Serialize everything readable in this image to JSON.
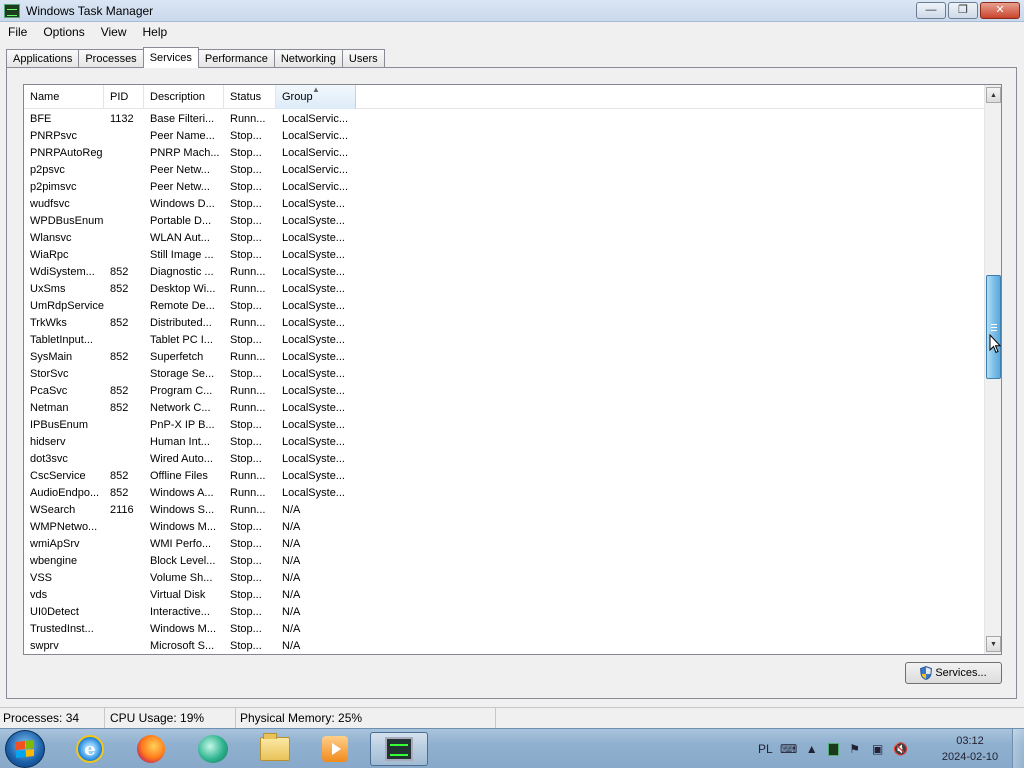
{
  "window": {
    "title": "Windows Task Manager",
    "minimize_symbol": "—",
    "restore_symbol": "❐",
    "close_symbol": "✕"
  },
  "menu": [
    "File",
    "Options",
    "View",
    "Help"
  ],
  "tabs": [
    {
      "label": "Applications",
      "active": false
    },
    {
      "label": "Processes",
      "active": false
    },
    {
      "label": "Services",
      "active": true
    },
    {
      "label": "Performance",
      "active": false
    },
    {
      "label": "Networking",
      "active": false
    },
    {
      "label": "Users",
      "active": false
    }
  ],
  "list": {
    "columns": [
      "Name",
      "PID",
      "Description",
      "Status",
      "Group"
    ],
    "sorted_column": "Group",
    "rows": [
      [
        "BFE",
        "1132",
        "Base Filteri...",
        "Runn...",
        "LocalServic..."
      ],
      [
        "PNRPsvc",
        "",
        "Peer Name...",
        "Stop...",
        "LocalServic..."
      ],
      [
        "PNRPAutoReg",
        "",
        "PNRP Mach...",
        "Stop...",
        "LocalServic..."
      ],
      [
        "p2psvc",
        "",
        "Peer Netw...",
        "Stop...",
        "LocalServic..."
      ],
      [
        "p2pimsvc",
        "",
        "Peer Netw...",
        "Stop...",
        "LocalServic..."
      ],
      [
        "wudfsvc",
        "",
        "Windows D...",
        "Stop...",
        "LocalSyste..."
      ],
      [
        "WPDBusEnum",
        "",
        "Portable D...",
        "Stop...",
        "LocalSyste..."
      ],
      [
        "Wlansvc",
        "",
        "WLAN Aut...",
        "Stop...",
        "LocalSyste..."
      ],
      [
        "WiaRpc",
        "",
        "Still Image ...",
        "Stop...",
        "LocalSyste..."
      ],
      [
        "WdiSystem...",
        "852",
        "Diagnostic ...",
        "Runn...",
        "LocalSyste..."
      ],
      [
        "UxSms",
        "852",
        "Desktop Wi...",
        "Runn...",
        "LocalSyste..."
      ],
      [
        "UmRdpService",
        "",
        "Remote De...",
        "Stop...",
        "LocalSyste..."
      ],
      [
        "TrkWks",
        "852",
        "Distributed...",
        "Runn...",
        "LocalSyste..."
      ],
      [
        "TabletInput...",
        "",
        "Tablet PC I...",
        "Stop...",
        "LocalSyste..."
      ],
      [
        "SysMain",
        "852",
        "Superfetch",
        "Runn...",
        "LocalSyste..."
      ],
      [
        "StorSvc",
        "",
        "Storage Se...",
        "Stop...",
        "LocalSyste..."
      ],
      [
        "PcaSvc",
        "852",
        "Program C...",
        "Runn...",
        "LocalSyste..."
      ],
      [
        "Netman",
        "852",
        "Network C...",
        "Runn...",
        "LocalSyste..."
      ],
      [
        "IPBusEnum",
        "",
        "PnP-X IP B...",
        "Stop...",
        "LocalSyste..."
      ],
      [
        "hidserv",
        "",
        "Human Int...",
        "Stop...",
        "LocalSyste..."
      ],
      [
        "dot3svc",
        "",
        "Wired Auto...",
        "Stop...",
        "LocalSyste..."
      ],
      [
        "CscService",
        "852",
        "Offline Files",
        "Runn...",
        "LocalSyste..."
      ],
      [
        "AudioEndpo...",
        "852",
        "Windows A...",
        "Runn...",
        "LocalSyste..."
      ],
      [
        "WSearch",
        "2116",
        "Windows S...",
        "Runn...",
        "N/A"
      ],
      [
        "WMPNetwo...",
        "",
        "Windows M...",
        "Stop...",
        "N/A"
      ],
      [
        "wmiApSrv",
        "",
        "WMI Perfo...",
        "Stop...",
        "N/A"
      ],
      [
        "wbengine",
        "",
        "Block Level...",
        "Stop...",
        "N/A"
      ],
      [
        "VSS",
        "",
        "Volume Sh...",
        "Stop...",
        "N/A"
      ],
      [
        "vds",
        "",
        "Virtual Disk",
        "Stop...",
        "N/A"
      ],
      [
        "UI0Detect",
        "",
        "Interactive...",
        "Stop...",
        "N/A"
      ],
      [
        "TrustedInst...",
        "",
        "Windows M...",
        "Stop...",
        "N/A"
      ],
      [
        "swprv",
        "",
        "Microsoft S...",
        "Stop...",
        "N/A"
      ]
    ]
  },
  "services_button": "Services...",
  "statusbar": {
    "processes": "Processes: 34",
    "cpu": "CPU Usage: 19%",
    "memory": "Physical Memory: 25%"
  },
  "taskbar": {
    "apps": [
      "internet-explorer-icon",
      "firefox-icon",
      "cyberlink-icon",
      "file-explorer-icon",
      "media-player-icon",
      "task-manager-icon"
    ],
    "tray_language": "PL",
    "clock_time": "03:12",
    "clock_date": "2024-02-10"
  },
  "colors": {
    "sorted_header": "#dcebf8",
    "scroll_thumb": "#7ec1ea",
    "taskbar": "#8fb0cf"
  }
}
